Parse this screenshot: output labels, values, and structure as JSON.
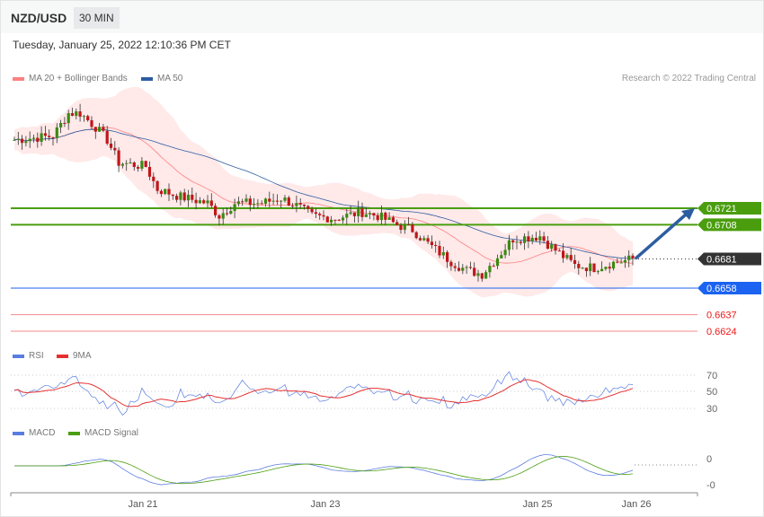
{
  "header": {
    "pair": "NZD/USD",
    "timeframe": "30 MIN",
    "datetime": "Tuesday, January 25, 2022 12:10:36 PM CET"
  },
  "legend": {
    "ma20": "MA 20 + Bollinger Bands",
    "ma50": "MA 50",
    "rsi": "RSI",
    "rsi_ma": "9MA",
    "macd": "MACD",
    "macd_signal": "MACD Signal"
  },
  "research": "Research © 2022 Trading Central",
  "colors": {
    "ma20": "#ff8080",
    "ma50": "#2d5da1",
    "resistance": "#4a9e0e",
    "support_blue": "#1b63f0",
    "support_red": "#f03c3c",
    "last": "#333333",
    "rsi": "#5b7de0",
    "rsi_ma": "#e53030",
    "macd": "#5b7de0",
    "signal": "#4a9e0e"
  },
  "chart_data": {
    "type": "candlestick",
    "title": "NZD/USD 30 MIN",
    "candle_count": 161,
    "close_path": [
      [
        0,
        0.6775
      ],
      [
        10,
        0.6778
      ],
      [
        14,
        0.6796
      ],
      [
        17,
        0.6796
      ],
      [
        21,
        0.6785
      ],
      [
        24,
        0.6775
      ],
      [
        27,
        0.6757
      ],
      [
        34,
        0.6754
      ],
      [
        37,
        0.6736
      ],
      [
        43,
        0.673
      ],
      [
        50,
        0.6725
      ],
      [
        53,
        0.6715
      ],
      [
        57,
        0.6725
      ],
      [
        64,
        0.6725
      ],
      [
        69,
        0.6729
      ],
      [
        73,
        0.6723
      ],
      [
        77,
        0.6715
      ],
      [
        83,
        0.6713
      ],
      [
        90,
        0.6718
      ],
      [
        94,
        0.6715
      ],
      [
        99,
        0.6708
      ],
      [
        103,
        0.6704
      ],
      [
        107,
        0.6693
      ],
      [
        113,
        0.6679
      ],
      [
        117,
        0.6672
      ],
      [
        121,
        0.6669
      ],
      [
        124,
        0.6679
      ],
      [
        129,
        0.6697
      ],
      [
        136,
        0.6699
      ],
      [
        138,
        0.6693
      ],
      [
        142,
        0.6683
      ],
      [
        145,
        0.6676
      ],
      [
        150,
        0.6674
      ],
      [
        155,
        0.6678
      ],
      [
        160,
        0.6681
      ]
    ],
    "levels": [
      {
        "label": "0.6721",
        "value": 0.6721,
        "kind": "resistance"
      },
      {
        "label": "0.6708",
        "value": 0.6708,
        "kind": "resistance"
      },
      {
        "label": "0.6681",
        "value": 0.6681,
        "kind": "last"
      },
      {
        "label": "0.6658",
        "value": 0.6658,
        "kind": "support_blue"
      },
      {
        "label": "0.6637",
        "value": 0.6637,
        "kind": "support_red"
      },
      {
        "label": "0.6624",
        "value": 0.6624,
        "kind": "support_red"
      }
    ],
    "forecast_target": 0.6721,
    "rsi_ticks": [
      "70",
      "50",
      "30"
    ],
    "macd_ticks": [
      "0",
      "-0"
    ],
    "x_ticks": [
      "Jan 21",
      "Jan 23",
      "Jan 25",
      "Jan 26"
    ]
  }
}
